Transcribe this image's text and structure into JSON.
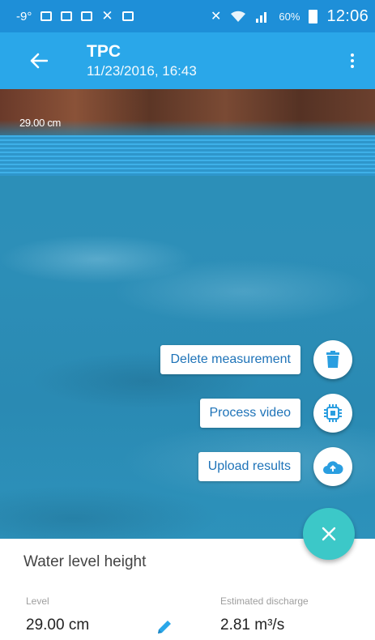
{
  "status_bar": {
    "temperature": "-9°",
    "battery_percent": "60%",
    "time": "12:06"
  },
  "app_bar": {
    "title": "TPC",
    "subtitle": "11/23/2016, 16:43"
  },
  "video": {
    "level_overlay_label": "29.00 cm"
  },
  "speed_dial": {
    "delete_label": "Delete measurement",
    "process_label": "Process video",
    "upload_label": "Upload results"
  },
  "info": {
    "section_title": "Water level height",
    "level_label": "Level",
    "level_value": "29.00 cm",
    "discharge_label": "Estimated discharge",
    "discharge_value": "2.81 m³/s"
  },
  "colors": {
    "status_bar": "#1e8fd8",
    "app_bar": "#2aa7e9",
    "fab": "#3cc8c8",
    "dial_text": "#1e73b8",
    "edit_icon": "#2aa7e9"
  }
}
